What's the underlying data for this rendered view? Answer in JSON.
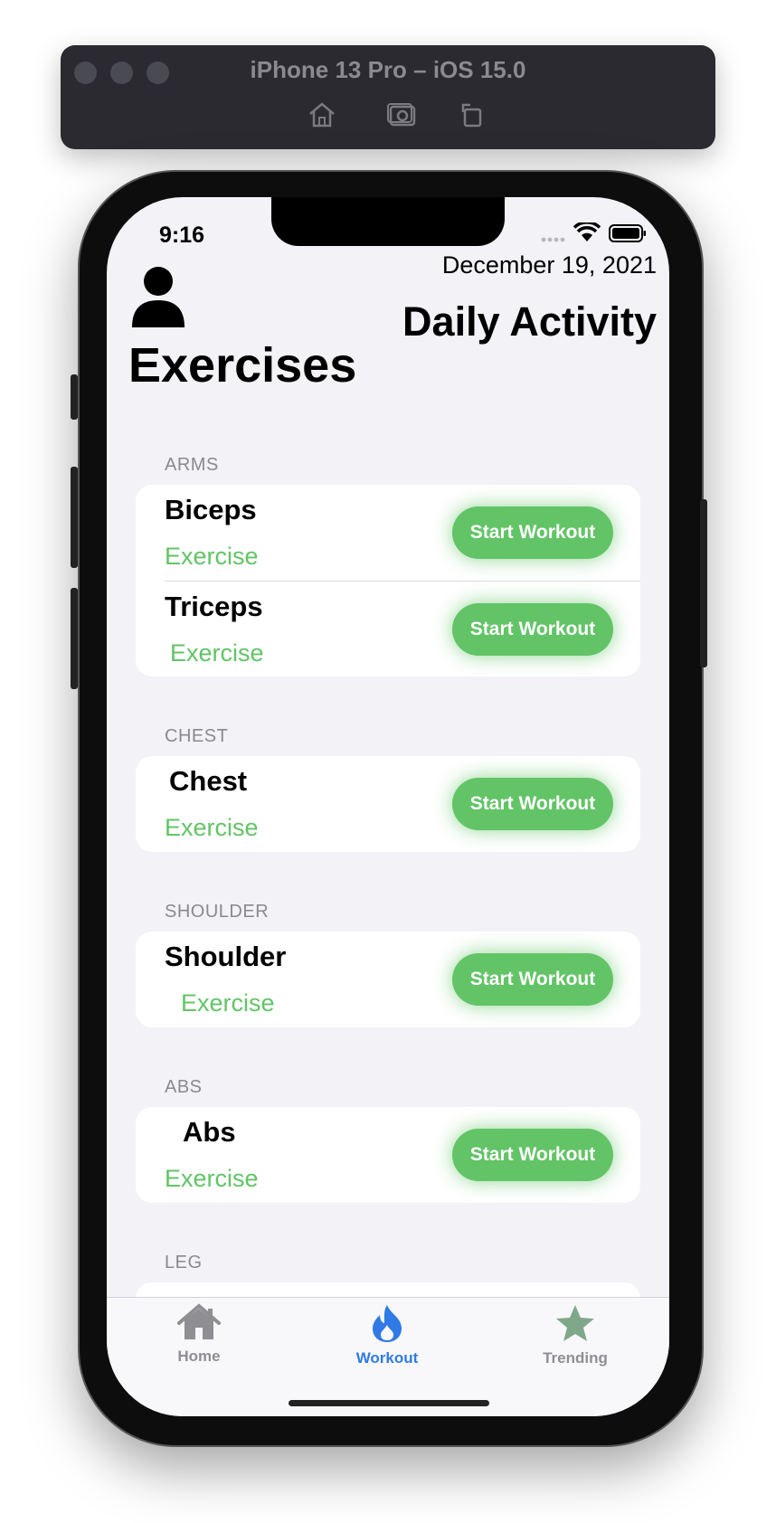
{
  "simulator": {
    "title": "iPhone 13 Pro – iOS 15.0"
  },
  "status_bar": {
    "time": "9:16"
  },
  "header": {
    "date": "December 19, 2021",
    "daily_title": "Daily Activity",
    "page_title": "Exercises"
  },
  "sections": [
    {
      "header": "ARMS",
      "items": [
        {
          "title": "Biceps",
          "subtitle": "Exercise",
          "button": "Start Workout"
        },
        {
          "title": "Triceps",
          "subtitle": "Exercise",
          "button": "Start Workout"
        }
      ]
    },
    {
      "header": "CHEST",
      "items": [
        {
          "title": "Chest",
          "subtitle": "Exercise",
          "button": "Start Workout"
        }
      ]
    },
    {
      "header": "SHOULDER",
      "items": [
        {
          "title": "Shoulder",
          "subtitle": "Exercise",
          "button": "Start Workout"
        }
      ]
    },
    {
      "header": "ABS",
      "items": [
        {
          "title": "Abs",
          "subtitle": "Exercise",
          "button": "Start Workout"
        }
      ]
    },
    {
      "header": "LEG",
      "items": []
    }
  ],
  "tabbar": {
    "items": [
      {
        "label": "Home",
        "icon": "house-icon"
      },
      {
        "label": "Workout",
        "icon": "flame-icon",
        "active": true
      },
      {
        "label": "Trending",
        "icon": "star-icon"
      }
    ]
  },
  "colors": {
    "accent_green": "#62c466",
    "tab_active": "#2f7ae5",
    "tab_inactive": "#8e8e93"
  }
}
